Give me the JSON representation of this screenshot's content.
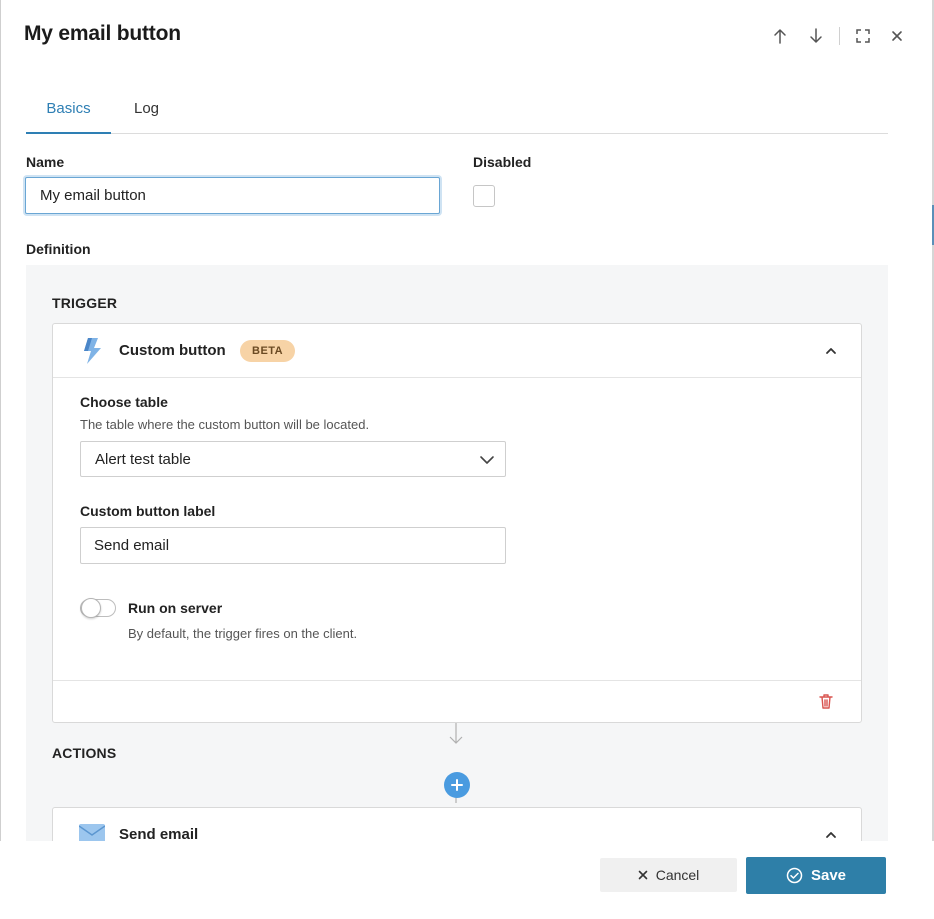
{
  "dialog": {
    "title": "My email button"
  },
  "tabs": [
    {
      "label": "Basics",
      "active": true
    },
    {
      "label": "Log",
      "active": false
    }
  ],
  "form": {
    "name_label": "Name",
    "name_value": "My email button",
    "disabled_label": "Disabled",
    "disabled_checked": false,
    "definition_label": "Definition"
  },
  "trigger": {
    "section_label": "TRIGGER",
    "title": "Custom button",
    "badge": "BETA",
    "choose_table_label": "Choose table",
    "choose_table_help": "The table where the custom button will be located.",
    "table_value": "Alert test table",
    "button_label_label": "Custom button label",
    "button_label_value": "Send email",
    "run_on_server_label": "Run on server",
    "run_on_server_help": "By default, the trigger fires on the client.",
    "run_on_server_on": false
  },
  "actions": {
    "section_label": "ACTIONS",
    "items": [
      {
        "title": "Send email"
      }
    ]
  },
  "footer": {
    "cancel_label": "Cancel",
    "save_label": "Save"
  },
  "colors": {
    "accent": "#2e7fb4",
    "save": "#2e7fa8",
    "beta_badge": "#f7d3a6",
    "delete": "#d9534f",
    "plus": "#4a9be0"
  }
}
